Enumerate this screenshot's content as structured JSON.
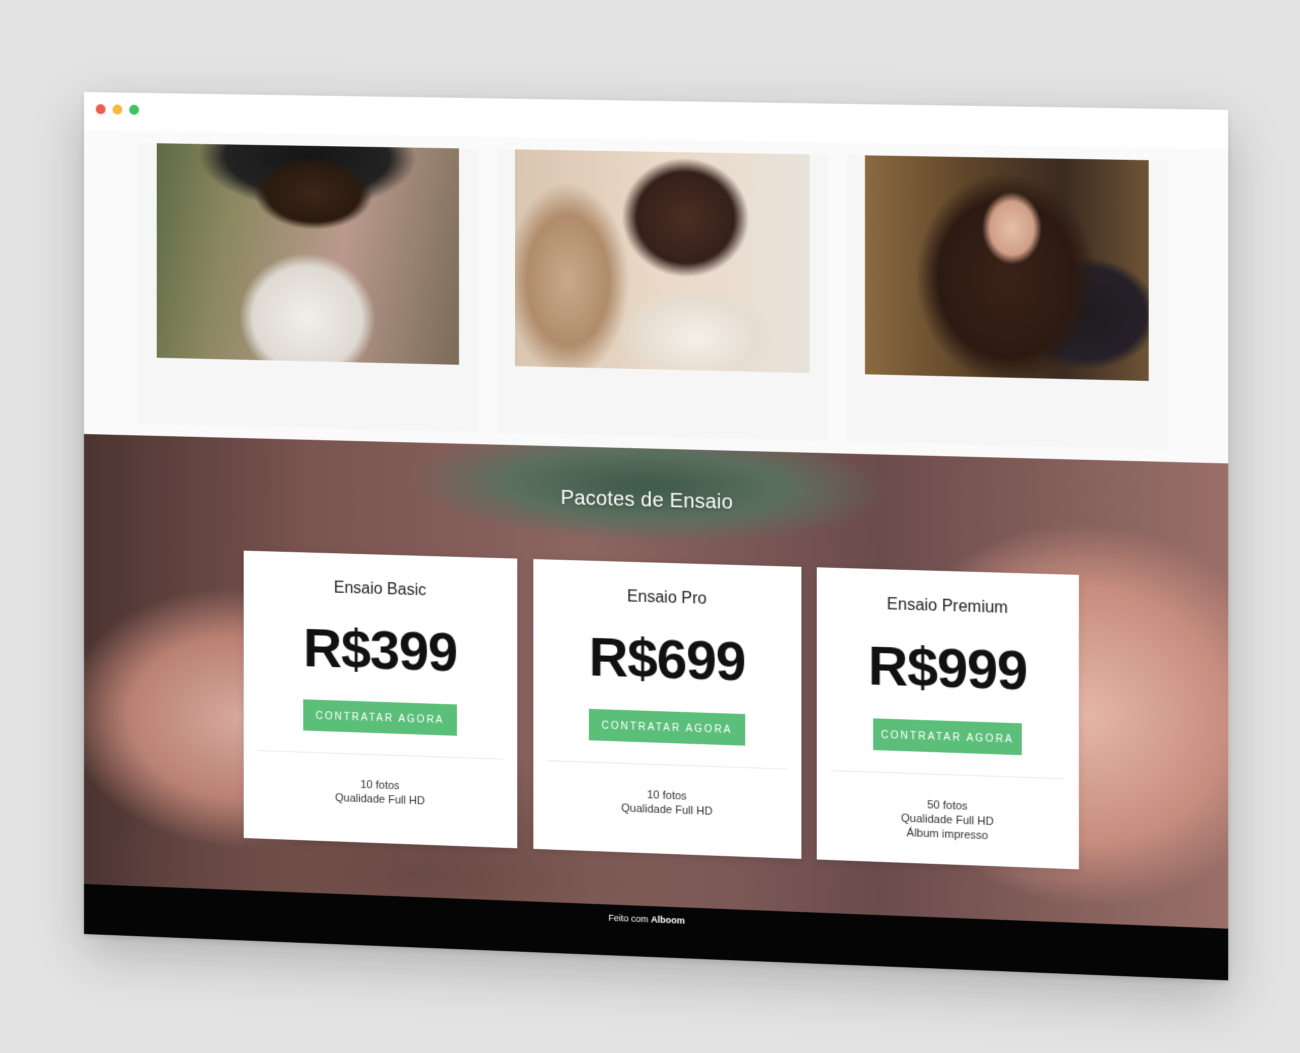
{
  "window": {
    "controls": [
      "close",
      "minimize",
      "maximize"
    ]
  },
  "gallery": {
    "photos": [
      {
        "icon": "portrait-photo"
      },
      {
        "icon": "portrait-photo"
      },
      {
        "icon": "portrait-photo"
      }
    ]
  },
  "packages": {
    "title": "Pacotes de Ensaio",
    "plans": [
      {
        "name": "Ensaio Basic",
        "price": "R$399",
        "button": "CONTRATAR AGORA",
        "features": [
          "10 fotos",
          "Qualidade Full HD"
        ]
      },
      {
        "name": "Ensaio Pro",
        "price": "R$699",
        "button": "CONTRATAR AGORA",
        "features": [
          "10 fotos",
          "Qualidade Full HD"
        ]
      },
      {
        "name": "Ensaio Premium",
        "price": "R$999",
        "button": "CONTRATAR AGORA",
        "features": [
          "50 fotos",
          "Qualidade Full HD",
          "Álbum impresso"
        ]
      }
    ]
  },
  "footer": {
    "prefix": "Feito com",
    "brand": "Alboom"
  },
  "colors": {
    "accent": "#5bbf7a",
    "close_dot": "#f05a4f",
    "minimize_dot": "#f6b93b",
    "maximize_dot": "#3cc463",
    "footer_bg": "#050505"
  }
}
